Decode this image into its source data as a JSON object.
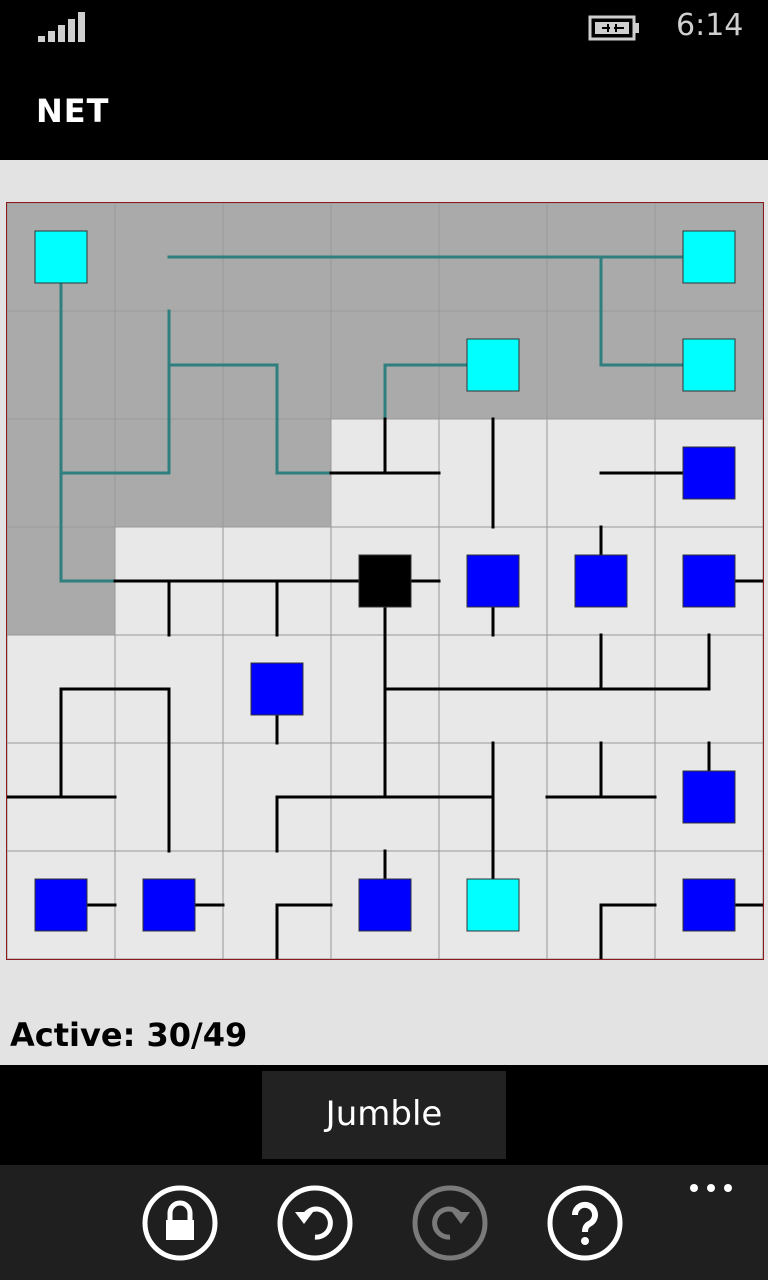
{
  "status_bar": {
    "time": "6:14",
    "signal_icon": "signal-bars-icon",
    "battery_icon": "battery-charging-icon"
  },
  "app": {
    "title": "NET"
  },
  "game": {
    "rows": 7,
    "cols": 7,
    "colors": {
      "powered_cell": "#aaaaaa",
      "unpowered_cell": "#e8e8e8",
      "grid_line": "#999999",
      "powered_wire": "#2f7f7f",
      "unpowered_wire": "#000000",
      "lit_terminal": "#00ffff",
      "unlit_terminal": "#0000ff",
      "server": "#000000",
      "board_border": "#8b1a1a"
    },
    "cells": [
      [
        {
          "c": "S",
          "t": "T",
          "on": true
        },
        {
          "c": "ER",
          "on": true
        },
        {
          "c": "EW",
          "on": true
        },
        {
          "c": "EW",
          "on": true
        },
        {
          "c": "EW",
          "on": true
        },
        {
          "c": "ESW",
          "on": true
        },
        {
          "c": "W",
          "t": "T",
          "on": true
        }
      ],
      [
        {
          "c": "NS",
          "on": true
        },
        {
          "c": "NES",
          "on": true
        },
        {
          "c": "WS",
          "on": true
        },
        {
          "c": "ES",
          "on": true
        },
        {
          "c": "W",
          "t": "T",
          "on": true
        },
        {
          "c": "NE",
          "on": true
        },
        {
          "c": "W",
          "t": "T",
          "on": true
        }
      ],
      [
        {
          "c": "NES",
          "on": true
        },
        {
          "c": "NW",
          "on": true
        },
        {
          "c": "NE",
          "on": true
        },
        {
          "c": "NWE",
          "on": false
        },
        {
          "c": "NS",
          "on": false
        },
        {
          "c": "E",
          "on": false
        },
        {
          "c": "W",
          "t": "T",
          "on": false
        }
      ],
      [
        {
          "c": "NE",
          "on": true
        },
        {
          "c": "EWS",
          "on": false
        },
        {
          "c": "EWS",
          "on": false
        },
        {
          "c": "EWS",
          "t": "SRV",
          "on": false
        },
        {
          "c": "S",
          "t": "T",
          "on": false
        },
        {
          "c": "N",
          "t": "T",
          "on": false
        },
        {
          "c": "E",
          "t": "T",
          "on": false
        }
      ],
      [
        {
          "c": "ES",
          "on": false
        },
        {
          "c": "WS",
          "on": false
        },
        {
          "c": "S",
          "t": "T",
          "on": false
        },
        {
          "c": "NSE",
          "on": false
        },
        {
          "c": "EW",
          "on": false
        },
        {
          "c": "NEW",
          "on": false
        },
        {
          "c": "NW",
          "on": false
        }
      ],
      [
        {
          "c": "NEW",
          "on": false
        },
        {
          "c": "NS",
          "on": false
        },
        {
          "c": "ES",
          "on": false
        },
        {
          "c": "NEW",
          "on": false
        },
        {
          "c": "NSW",
          "on": false
        },
        {
          "c": "NEW",
          "on": false
        },
        {
          "c": "N",
          "t": "T",
          "on": false
        }
      ],
      [
        {
          "c": "E",
          "t": "T",
          "on": false
        },
        {
          "c": "E",
          "t": "T",
          "on": false
        },
        {
          "c": "ES",
          "on": false
        },
        {
          "c": "N",
          "t": "T",
          "on": false
        },
        {
          "c": "N",
          "t": "T",
          "on": false
        },
        {
          "c": "ES",
          "on": false
        },
        {
          "c": "E",
          "t": "T",
          "on": false
        }
      ]
    ],
    "status": "Active: 30/49"
  },
  "actions": {
    "jumble_label": "Jumble"
  },
  "app_bar": {
    "lock_icon": "lock-icon",
    "undo_icon": "undo-icon",
    "redo_icon": "redo-icon",
    "help_icon": "help-icon",
    "more_icon": "more-dots-icon",
    "redo_enabled": false
  }
}
